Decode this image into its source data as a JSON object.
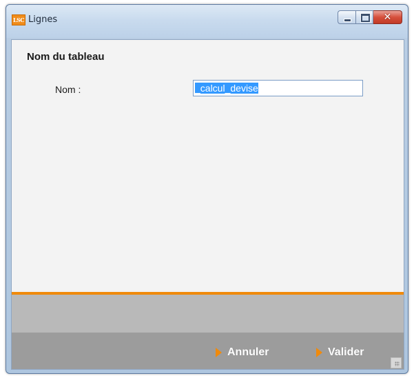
{
  "window": {
    "app_icon_text": "LSC",
    "title": "Lignes",
    "controls": {
      "minimize": "minimize-icon",
      "maximize": "maximize-icon",
      "close": "close-icon",
      "close_glyph": "✕"
    }
  },
  "form": {
    "section_title": "Nom du tableau",
    "name_label": "Nom :",
    "name_value": "_calcul_devise"
  },
  "footer": {
    "cancel_label": "Annuler",
    "validate_label": "Valider",
    "arrow_icon": "play-arrow-icon",
    "grip_icon": "resize-grip-icon"
  },
  "colors": {
    "accent": "#f08a0c",
    "footer_light": "#b9b9b9",
    "footer_dark": "#9c9c9c",
    "content_bg": "#f3f3f3",
    "titlebar": "#c9dbee"
  }
}
